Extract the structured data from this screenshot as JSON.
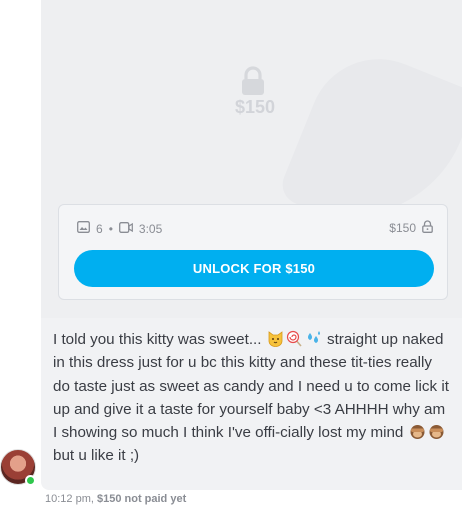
{
  "preview": {
    "price_overlay": "$150"
  },
  "card": {
    "photo_count": "6",
    "video_duration": "3:05",
    "price": "$150",
    "unlock_label": "UNLOCK FOR $150"
  },
  "caption": {
    "part1": "I told you this kitty was sweet...",
    "part2": "straight up naked in this dress just for u bc this kitty and these tit-ties really do taste just as sweet as candy and I need u to come lick it up and give it a taste for yourself baby <3 AHHHH why am I showing so much I think I've offi-cially lost my mind",
    "part3": "but u like it ;)",
    "emojis_after_part1": [
      "cat-face-icon",
      "lollipop-icon",
      "sweat-droplets-icon"
    ],
    "emojis_after_part2": [
      "see-no-evil-monkey-icon",
      "see-no-evil-monkey-icon"
    ]
  },
  "footer": {
    "time": "10:12 pm,",
    "status": "$150 not paid yet"
  },
  "colors": {
    "accent": "#00aff0",
    "online": "#2fc74d",
    "bubble": "#f1f2f4"
  }
}
